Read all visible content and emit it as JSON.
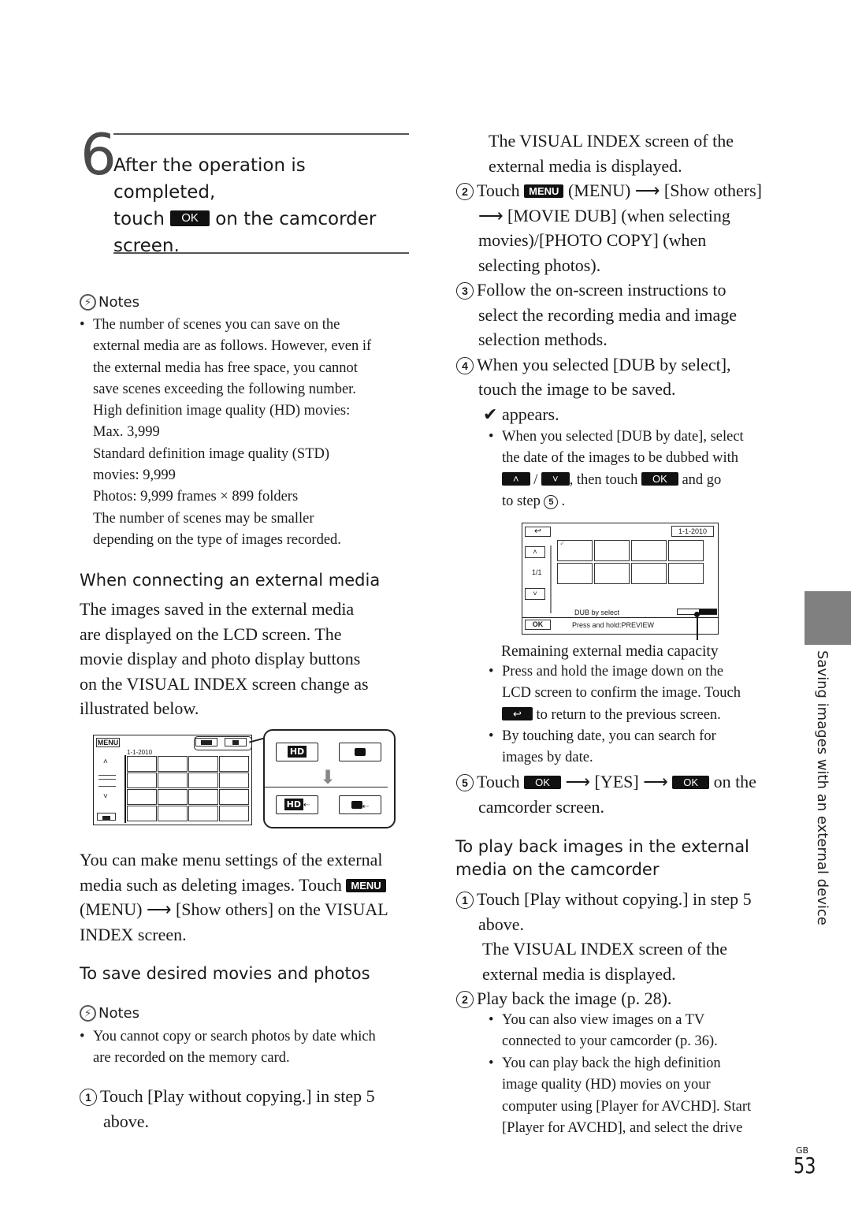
{
  "step6": {
    "number": "6",
    "line1": "After the operation is completed,",
    "line2a": "touch",
    "ok": "OK",
    "line2b": "on the camcorder",
    "line3": "screen."
  },
  "notes1": {
    "title": "Notes",
    "lines": [
      "The number of scenes you can save on the",
      "external media are as follows. However, even if",
      "the external media has free space, you cannot",
      "save scenes exceeding the following number.",
      "High definition image quality (HD) movies:",
      "Max. 3,999",
      "Standard definition image quality (STD)",
      "movies: 9,999",
      "Photos: 9,999 frames × 899 folders",
      "The number of scenes may be smaller",
      "depending on the type of images recorded."
    ]
  },
  "connect": {
    "heading": "When connecting an external media",
    "lines": [
      "The images saved in the external media",
      "are displayed on the LCD screen. The",
      "movie display and photo display buttons",
      "on the VISUAL INDEX screen change as",
      "illustrated below."
    ]
  },
  "figure1": {
    "menu": "MENU",
    "date": "1-1-2010",
    "hd_label": "HD",
    "down_arrow": "⬇"
  },
  "menu_para": {
    "l1": "You can make menu settings of the external",
    "l2": "media such as deleting images. Touch",
    "menu_key": "MENU",
    "l3a": "(MENU)",
    "arrow": "⟶",
    "l3b": "[Show others] on the VISUAL",
    "l4": "INDEX screen."
  },
  "save": {
    "heading": "To save desired movies and photos",
    "notes_title": "Notes",
    "note_lines": [
      "You cannot copy or search photos by date which",
      "are recorded on the memory card."
    ],
    "step1_num": "1",
    "step1_l1": "Touch [Play without copying.] in step 5",
    "step1_l2": "above."
  },
  "right": {
    "cont1": "The VISUAL INDEX screen of the",
    "cont2": "external media is displayed.",
    "s2_num": "2",
    "s2_a": "Touch",
    "menu_key": "MENU",
    "s2_b": "(MENU) ⟶ [Show others]",
    "s2_l2": "⟶ [MOVIE DUB] (when selecting",
    "s2_l3": "movies)/[PHOTO COPY] (when",
    "s2_l4": "selecting photos).",
    "s3_num": "3",
    "s3_l1": "Follow the on-screen instructions to",
    "s3_l2": "select the recording media and image",
    "s3_l3": "selection methods.",
    "s4_num": "4",
    "s4_l1": "When you selected [DUB by select],",
    "s4_l2": "touch the image to be saved.",
    "check": "✔",
    "appears": "appears.",
    "b1_l1": "When you selected [DUB by date], select",
    "b1_l2": "the date of the images to be dubbed with",
    "up": "˄",
    "slash": "/",
    "down": "˅",
    "b1_l3a": ", then touch",
    "ok": "OK",
    "b1_l3b": "and go",
    "b1_l4": "to step",
    "step5_ref": "5",
    "lcd": {
      "date": "1-1-2010",
      "page": "1/1",
      "mode": "DUB by select",
      "ok": "OK",
      "hint": "Press and hold:PREVIEW",
      "capacity_remaining_fraction": 0.55
    },
    "caption": "Remaining external media capacity",
    "b2_l1": "Press and hold the image down on the",
    "b2_l2": "LCD screen to confirm the image. Touch",
    "b2_l3": "to return to the previous screen.",
    "b3_l1": "By touching date, you can search for",
    "b3_l2": "images by date.",
    "s5_num": "5",
    "s5_a": "Touch",
    "s5_b": "⟶ [YES] ⟶",
    "s5_c": "on the",
    "s5_l2": "camcorder screen."
  },
  "playback": {
    "heading1": "To play back images in the external",
    "heading2": "media on the camcorder",
    "s1_num": "1",
    "s1_l1": "Touch [Play without copying.] in step 5",
    "s1_l2": "above.",
    "cont1": "The VISUAL INDEX screen of the",
    "cont2": "external media is displayed.",
    "s2_num": "2",
    "s2_l1": "Play back the image (p. 28).",
    "b1_l1": "You can also view images on a TV",
    "b1_l2": "connected to your camcorder (p. 36).",
    "b2_l1": "You can play back the high definition",
    "b2_l2": "image quality (HD) movies on your",
    "b2_l3": "computer using [Player for AVCHD]. Start",
    "b2_l4": "[Player for AVCHD], and select the drive"
  },
  "side_label": "Saving images with an external device",
  "footer": {
    "region": "GB",
    "page": "53"
  }
}
